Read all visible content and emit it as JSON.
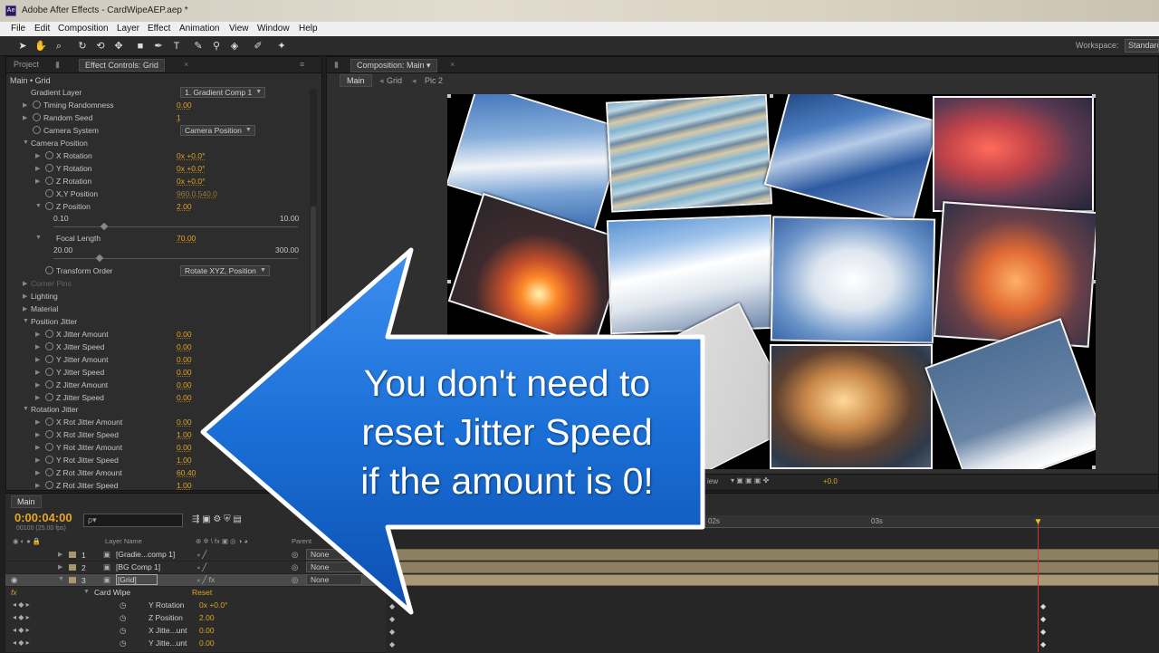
{
  "window": {
    "title": "Adobe After Effects - CardWipeAEP.aep *",
    "logo": "Ae"
  },
  "menu": [
    "File",
    "Edit",
    "Composition",
    "Layer",
    "Effect",
    "Animation",
    "View",
    "Window",
    "Help"
  ],
  "toolbar": {
    "workspace_label": "Workspace:",
    "workspace_value": "Standard"
  },
  "effect_panel": {
    "tab_project": "Project",
    "tab_effect": "Effect Controls: Grid",
    "subtitle": "Main • Grid",
    "rows": [
      {
        "label": "Gradient Layer",
        "dropdown": "1. Gradient Comp 1"
      },
      {
        "label": "Timing Randomness",
        "value": "0.00"
      },
      {
        "label": "Random Seed",
        "value": "1"
      },
      {
        "label": "Camera System",
        "dropdown": "Camera Position"
      },
      {
        "label": "Camera Position"
      },
      {
        "label": "X Rotation",
        "value": "0x +0.0°"
      },
      {
        "label": "Y Rotation",
        "value": "0x +0.0°"
      },
      {
        "label": "Z Rotation",
        "value": "0x +0.0°"
      },
      {
        "label": "X,Y Position",
        "value": "960.0,540.0"
      },
      {
        "label": "Z Position",
        "value": "2.00"
      },
      {
        "label": "Focal Length",
        "value": "70.00"
      },
      {
        "label": "Transform Order",
        "dropdown": "Rotate XYZ, Position"
      },
      {
        "label": "Corner Pins"
      },
      {
        "label": "Lighting"
      },
      {
        "label": "Material"
      },
      {
        "label": "Position Jitter"
      },
      {
        "label": "X Jitter Amount",
        "value": "0.00"
      },
      {
        "label": "X Jitter Speed",
        "value": "0.00"
      },
      {
        "label": "Y Jitter Amount",
        "value": "0.00"
      },
      {
        "label": "Y Jitter Speed",
        "value": "0.00"
      },
      {
        "label": "Z Jitter Amount",
        "value": "0.00"
      },
      {
        "label": "Z Jitter Speed",
        "value": "0.00"
      },
      {
        "label": "Rotation Jitter"
      },
      {
        "label": "X Rot Jitter Amount",
        "value": "0.00"
      },
      {
        "label": "X Rot Jitter Speed",
        "value": "1.00"
      },
      {
        "label": "Y Rot Jitter Amount",
        "value": "0.00"
      },
      {
        "label": "Y Rot Jitter Speed",
        "value": "1.00"
      },
      {
        "label": "Z Rot Jitter Amount",
        "value": "60.40"
      },
      {
        "label": "Z Rot Jitter Speed",
        "value": "1.00"
      }
    ],
    "z_slider": {
      "min": "0.10",
      "max": "10.00"
    },
    "focal_slider": {
      "min": "20.00",
      "max": "300.00"
    }
  },
  "comp_panel": {
    "tab": "Composition: Main",
    "breadcrumbs": [
      "Main",
      "Grid",
      "Pic 2"
    ],
    "footer_view": "iew",
    "footer_exposure": "+0.0"
  },
  "timeline": {
    "tab": "Main",
    "timecode": "0:00:04:00",
    "fps": "00100 (25.00 fps)",
    "search_placeholder": "ρ▾",
    "col_layer_name": "Layer Name",
    "col_parent": "Parent",
    "ruler": [
      "02s",
      "03s"
    ],
    "layers": [
      {
        "num": "1",
        "name": "[Gradie...comp 1]",
        "parent": "None",
        "label_color": "#a89868"
      },
      {
        "num": "2",
        "name": "[BG Comp 1]",
        "parent": "None",
        "label_color": "#a89868"
      },
      {
        "num": "3",
        "name": "[Grid]",
        "parent": "None",
        "label_color": "#a89868"
      }
    ],
    "effect_name": "Card Wipe",
    "effect_reset": "Reset",
    "fx_label": "fx",
    "props": [
      {
        "label": "Y Rotation",
        "value": "0x +0.0°"
      },
      {
        "label": "Z Position",
        "value": "2.00"
      },
      {
        "label": "X Jitte...unt",
        "value": "0.00"
      },
      {
        "label": "Y Jitte...unt",
        "value": "0.00"
      }
    ]
  },
  "callout": {
    "line1": "You don't need to",
    "line2": "reset Jitter Speed",
    "line3": "if the amount is 0!"
  },
  "colors": {
    "accent_value": "#e0a423",
    "callout_blue": "#1a6fd6",
    "playhead": "#e03030"
  }
}
